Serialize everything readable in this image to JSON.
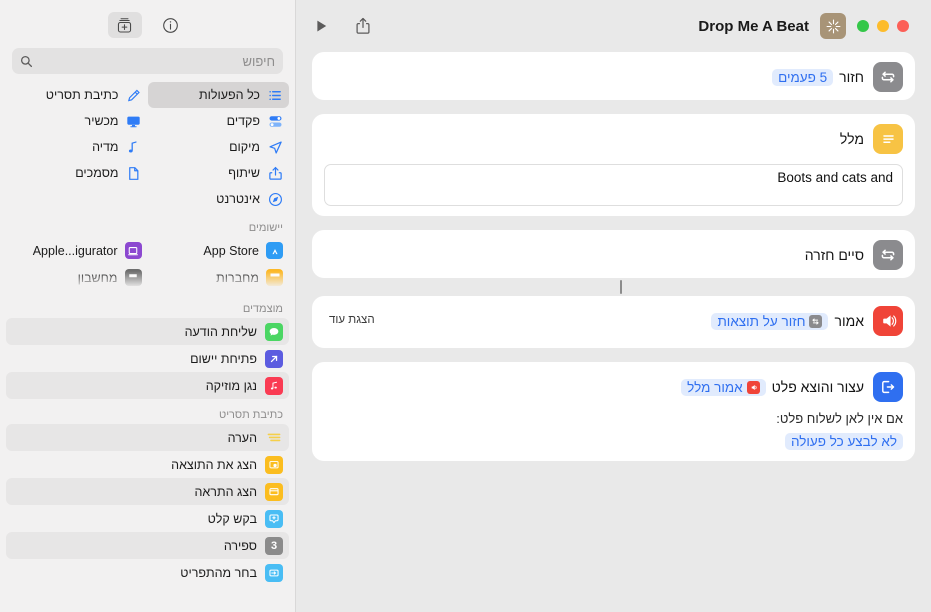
{
  "window": {
    "document_title": "Drop Me A Beat",
    "traffic_lights": [
      "#34c749",
      "#fdbc2c",
      "#fc5f57"
    ],
    "doc_glyph_bg": "#a89477"
  },
  "sidebar": {
    "toolbar": [
      {
        "name": "info-button",
        "icon": "info-circle-icon",
        "active": false
      },
      {
        "name": "add-action-button",
        "icon": "add-action-icon",
        "active": true
      }
    ],
    "search": {
      "placeholder": "חיפוש",
      "value": ""
    },
    "categories": [
      {
        "label": "כל הפעולות",
        "icon": "list-bullet-icon",
        "selected": true
      },
      {
        "label": "כתיבת תסריט",
        "icon": "scripting-icon",
        "selected": false
      },
      {
        "label": "פקדים",
        "icon": "controls-icon",
        "selected": false
      },
      {
        "label": "מכשיר",
        "icon": "display-icon",
        "selected": false
      },
      {
        "label": "מיקום",
        "icon": "location-arrow-icon",
        "selected": false
      },
      {
        "label": "מדיה",
        "icon": "music-note-icon",
        "selected": false
      },
      {
        "label": "שיתוף",
        "icon": "share-icon",
        "selected": false
      },
      {
        "label": "מסמכים",
        "icon": "document-icon",
        "selected": false
      },
      {
        "label": "אינטרנט",
        "icon": "safari-compass-icon",
        "selected": false
      }
    ],
    "sections": [
      {
        "title": "יישומים",
        "apps": [
          {
            "label": "App Store",
            "icon": "app-store-icon",
            "color": "#2f9cf4"
          },
          {
            "label": "Apple...igurator",
            "icon": "apple-configurator-icon",
            "color": "#8c48d0"
          },
          {
            "label": "מחברות",
            "icon": "notes-icon",
            "color": "#fcb827"
          },
          {
            "label": "מחשבון",
            "icon": "calculator-icon",
            "color": "#6e6e6e"
          }
        ]
      },
      {
        "title": "מוצמדים",
        "rows": [
          {
            "label": "שליחת הודעה",
            "icon": "messages-icon",
            "color": "#4bd663",
            "alt": true
          },
          {
            "label": "פתיחת יישום",
            "icon": "open-app-icon",
            "color": "#5c5ce0",
            "alt": false
          },
          {
            "label": "נגן מוזיקה",
            "icon": "music-icon",
            "color": "#fa3b53",
            "alt": true
          }
        ]
      },
      {
        "title": "כתיבת תסריט",
        "rows": [
          {
            "label": "הערה",
            "icon": "comment-lines-icon",
            "color": "#f5cf4a",
            "alt": true
          },
          {
            "label": "הצג את התוצאה",
            "icon": "show-result-icon",
            "color": "#fbbd1f",
            "alt": false
          },
          {
            "label": "הצג התראה",
            "icon": "show-alert-icon",
            "color": "#fbbd1f",
            "alt": true
          },
          {
            "label": "בקש קלט",
            "icon": "ask-input-icon",
            "color": "#49bdf4",
            "alt": false
          },
          {
            "label": "ספירה",
            "icon": "count-icon",
            "color": "#8b8b8b",
            "alt": true
          },
          {
            "label": "בחר מהתפריט",
            "icon": "choose-menu-icon",
            "color": "#49bdf4",
            "alt": false
          }
        ]
      }
    ]
  },
  "main": {
    "toolbar": {
      "play_label": "הפעל",
      "share_label": "שיתוף"
    },
    "actions": [
      {
        "name": "repeat-action",
        "icon": "repeat-icon",
        "icon_color": "#8b8b8e",
        "text_before": "חזור",
        "pill": "5 פעמים",
        "pill_icon": null
      },
      {
        "name": "text-action",
        "icon": "text-lines-icon",
        "icon_color": "#f7c344",
        "text_before": "מלל",
        "field_value": "Boots and cats and"
      },
      {
        "name": "end-repeat-action",
        "icon": "repeat-icon",
        "icon_color": "#8b8b8e",
        "text_before": "סיים חזרה"
      },
      {
        "name": "speak-text-action",
        "icon": "speaker-wave-icon",
        "icon_color": "#f04438",
        "text_before": "אמור",
        "pill": "חזור על תוצאות",
        "pill_icon_color": "#8b8b8e",
        "show_more": "הצגת עוד"
      },
      {
        "name": "stop-and-output-action",
        "icon": "stop-output-icon",
        "icon_color": "#2f6ff0",
        "text_before": "עצור והוצא פלט",
        "pill": "אמור מלל",
        "pill_icon_color": "#f04438",
        "sub_text": "אם אין לאן לשלוח פלט:",
        "link_text": "לא לבצע כל פעולה"
      }
    ]
  }
}
